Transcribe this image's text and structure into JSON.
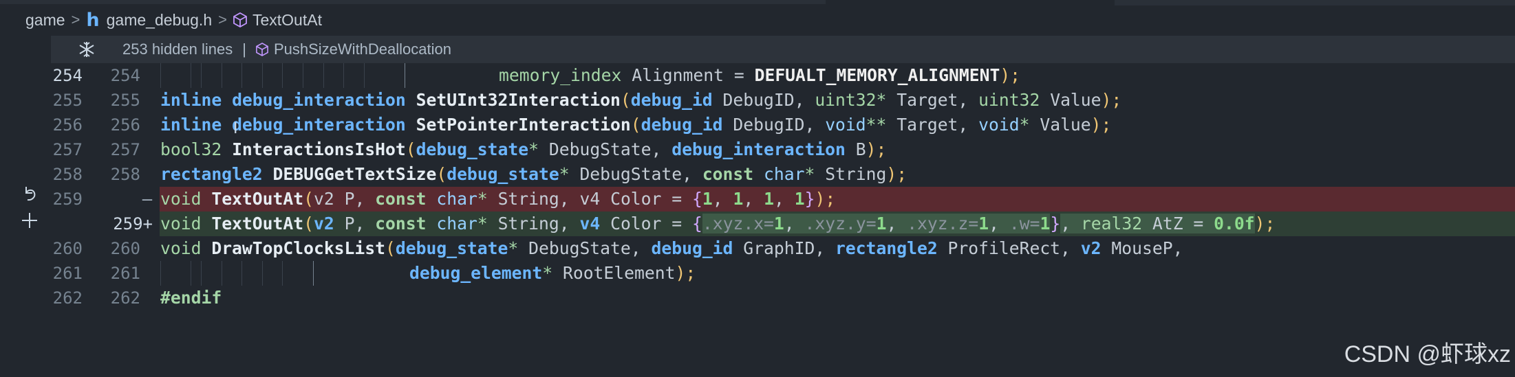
{
  "breadcrumb": {
    "folder": "game",
    "file": "game_debug.h",
    "symbol": "TextOutAt",
    "file_icon": "h-file-icon",
    "symbol_icon": "cube-icon"
  },
  "sticky": {
    "fold_icon": "fold-icon",
    "hidden_lines": "253 hidden lines",
    "separator": "|",
    "scope": "PushSizeWithDeallocation"
  },
  "lines": [
    {
      "left": "254",
      "right": "254",
      "marker": ""
    },
    {
      "left": "255",
      "right": "255",
      "marker": ""
    },
    {
      "left": "256",
      "right": "256",
      "marker": ""
    },
    {
      "left": "257",
      "right": "257",
      "marker": ""
    },
    {
      "left": "258",
      "right": "258",
      "marker": ""
    },
    {
      "left": "259",
      "right": "",
      "marker": "—"
    },
    {
      "left": "",
      "right": "259+",
      "marker": ""
    },
    {
      "left": "260",
      "right": "260",
      "marker": ""
    },
    {
      "left": "261",
      "right": "261",
      "marker": ""
    },
    {
      "left": "262",
      "right": "262",
      "marker": ""
    }
  ],
  "code": {
    "l254": [
      "memory_index",
      " Alignment = ",
      "DEFUALT_MEMORY_ALIGNMENT",
      ");"
    ],
    "l255": [
      "inline",
      " ",
      "debug_interaction",
      " ",
      "SetUInt32Interaction",
      "(",
      "debug_id",
      " DebugID, ",
      "uint32",
      "*",
      " Target, ",
      "uint32",
      " Value",
      ");"
    ],
    "l256": [
      "inline",
      " ",
      "debug_interaction",
      " ",
      "SetPointerInteraction",
      "(",
      "debug_id",
      " DebugID, ",
      "void",
      "**",
      " Target, ",
      "void",
      "*",
      " Value",
      ");"
    ],
    "l257": [
      "bool32",
      " ",
      "InteractionsIsHot",
      "(",
      "debug_state",
      "*",
      " DebugState, ",
      "debug_interaction",
      " B",
      ");"
    ],
    "l258": [
      "rectangle2",
      " ",
      "DEBUGGetTextSize",
      "(",
      "debug_state",
      "*",
      " DebugState, ",
      "const",
      " ",
      "char",
      "*",
      " String",
      ");"
    ],
    "l259": [
      "void",
      " ",
      "TextOutAt",
      "(",
      "v2",
      " P, ",
      "const",
      " ",
      "char",
      "*",
      " String, ",
      "v4",
      " Color = ",
      "{",
      "1",
      ", ",
      "1",
      ", ",
      "1",
      ", ",
      "1",
      "}",
      ");"
    ],
    "l259new": [
      "void",
      " ",
      "TextOutAt",
      "(",
      "v2",
      " P, ",
      "const",
      " ",
      "char",
      "*",
      " String, ",
      "v4",
      " Color = ",
      "{",
      ".xyz.x=",
      "1",
      ", ",
      ".xyz.y=",
      "1",
      ", ",
      ".xyz.z=",
      "1",
      ", ",
      ".w=",
      "1",
      "}",
      ", ",
      "real32",
      " AtZ = ",
      "0.0f",
      ");"
    ],
    "l260": [
      "void",
      " ",
      "DrawTopClocksList",
      "(",
      "debug_state",
      "*",
      " DebugState, ",
      "debug_id",
      " GraphID, ",
      "rectangle2",
      " ProfileRect, ",
      "v2",
      " MouseP,"
    ],
    "l261": [
      "debug_element",
      "*",
      " RootElement",
      ");"
    ],
    "l262": [
      "#endif"
    ]
  },
  "side_icons": {
    "revert": "revert-icon",
    "add": "add-comment-icon"
  },
  "watermark": "CSDN @虾球xz"
}
